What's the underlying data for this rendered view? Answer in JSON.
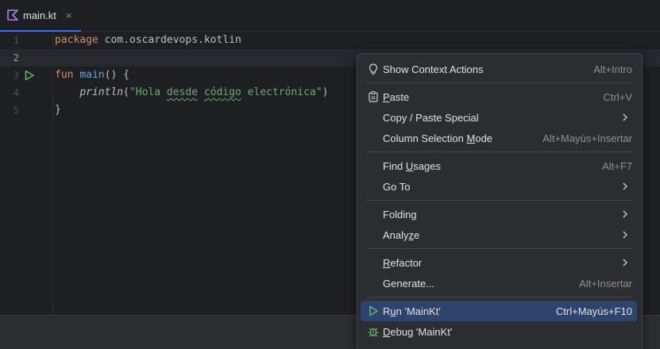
{
  "tab": {
    "label": "main.kt",
    "close": "×"
  },
  "editor": {
    "line_numbers": [
      "1",
      "2",
      "3",
      "4",
      "5"
    ],
    "line1": {
      "keyword": "package",
      "rest": " com.oscardevops.kotlin"
    },
    "line3": {
      "keyword": "fun",
      "fn": "main",
      "rest": "() {"
    },
    "line4": {
      "indent": "    ",
      "call": "println",
      "open": "(",
      "str_q1": "\"",
      "s1": "Hola",
      "s2": " ",
      "s3": "desde",
      "s4": " ",
      "s5": "código",
      "s6": " ",
      "s7": "electrónica",
      "str_q2": "\"",
      "close": ")"
    },
    "line5": {
      "text": "}"
    }
  },
  "menu": {
    "items": [
      {
        "pre": "Show Context Actions",
        "mn": "",
        "post": "",
        "shortcut": "Alt+Intro",
        "icon": "lightbulb-icon"
      },
      {
        "pre": "",
        "mn": "P",
        "post": "aste",
        "shortcut": "Ctrl+V",
        "icon": "clipboard-icon"
      },
      {
        "pre": "Copy / Paste Special",
        "mn": "",
        "post": "",
        "shortcut": "",
        "submenu": true
      },
      {
        "pre": "Column Selection ",
        "mn": "M",
        "post": "ode",
        "shortcut": "Alt+Mayús+Insertar"
      },
      {
        "pre": "Find ",
        "mn": "U",
        "post": "sages",
        "shortcut": "Alt+F7"
      },
      {
        "pre": "Go To",
        "mn": "",
        "post": "",
        "shortcut": "",
        "submenu": true
      },
      {
        "pre": "Folding",
        "mn": "",
        "post": "",
        "shortcut": "",
        "submenu": true
      },
      {
        "pre": "Analy",
        "mn": "z",
        "post": "e",
        "shortcut": "",
        "submenu": true
      },
      {
        "pre": "",
        "mn": "R",
        "post": "efactor",
        "shortcut": "",
        "submenu": true
      },
      {
        "pre": "Generate...",
        "mn": "",
        "post": "",
        "shortcut": "Alt+Insertar"
      },
      {
        "pre": "R",
        "mn": "u",
        "post": "n 'MainKt'",
        "shortcut": "Ctrl+Mayús+F10",
        "icon": "run-icon",
        "selected": true
      },
      {
        "pre": "",
        "mn": "D",
        "post": "ebug 'MainKt'",
        "shortcut": "",
        "icon": "debug-icon"
      }
    ]
  },
  "colors": {
    "accent": "#3574f0",
    "selection": "#2e436e",
    "run_green": "#5fb865",
    "debug_green": "#5fb865"
  }
}
